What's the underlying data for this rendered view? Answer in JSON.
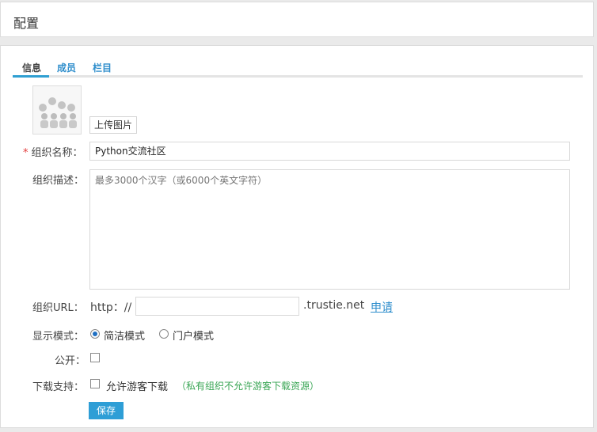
{
  "header": {
    "title": "配置"
  },
  "tabs": [
    {
      "label": "信息",
      "active": true
    },
    {
      "label": "成员",
      "active": false
    },
    {
      "label": "栏目",
      "active": false
    }
  ],
  "avatar": {
    "icon": "group-people-icon"
  },
  "upload": {
    "label": "上传图片"
  },
  "form": {
    "required_mark": "*",
    "name": {
      "label": "组织名称：",
      "value": "Python交流社区"
    },
    "description": {
      "label": "组织描述：",
      "placeholder": "最多3000个汉字（或6000个英文字符）"
    },
    "url": {
      "label": "组织URL：",
      "prefix": "http：//",
      "value": "",
      "suffix": ".trustie.net",
      "apply_label": "申请"
    },
    "display_mode": {
      "label": "显示模式：",
      "options": [
        "简洁模式",
        "门户模式"
      ],
      "selected": "简洁模式"
    },
    "public": {
      "label": "公开：",
      "checked": false
    },
    "download": {
      "label": "下载支持：",
      "option_label": "允许游客下载",
      "hint": "（私有组织不允许游客下载资源）",
      "checked": false
    }
  },
  "actions": {
    "save_label": "保存"
  },
  "colors": {
    "accent": "#2e9ed6",
    "link": "#2f8ecc",
    "required": "#e23b3b",
    "hint": "#3aa655"
  }
}
